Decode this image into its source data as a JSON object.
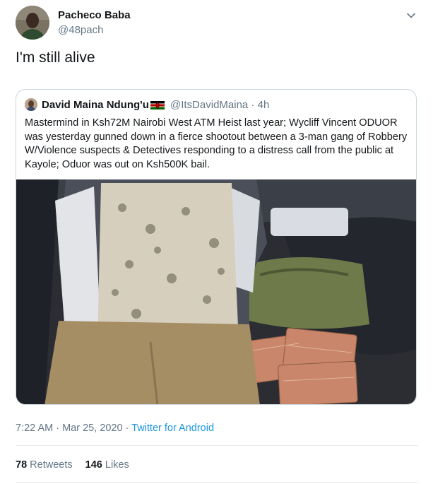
{
  "tweet": {
    "author_name": "Pacheco Baba",
    "author_handle": "@48pach",
    "text": "I'm still alive",
    "timestamp": "7:22 AM · Mar 25, 2020 · ",
    "source": "Twitter for Android",
    "stats": {
      "retweets_count": "78",
      "retweets_label": "Retweets",
      "likes_count": "146",
      "likes_label": "Likes"
    },
    "menu_icon": "chevron-down-icon"
  },
  "quoted": {
    "author_name": "David Maina Ndung'u",
    "author_handle": "@ItsDavidMaina · 4h",
    "flag_icon": "kenya-flag-icon",
    "text": "Mastermind in Ksh72M Nairobi West ATM Heist last year; Wycliff Vincent ODUOR was yesterday gunned down in a fierce shootout between a 3-man gang of Robbery W/Violence suspects & Detectives responding to a distress call from the public at Kayole; Oduor was out on Ksh500K bail."
  },
  "colors": {
    "text": "#14171a",
    "secondary": "#657786",
    "link": "#1b95e0",
    "border": "#ccd6dd"
  }
}
